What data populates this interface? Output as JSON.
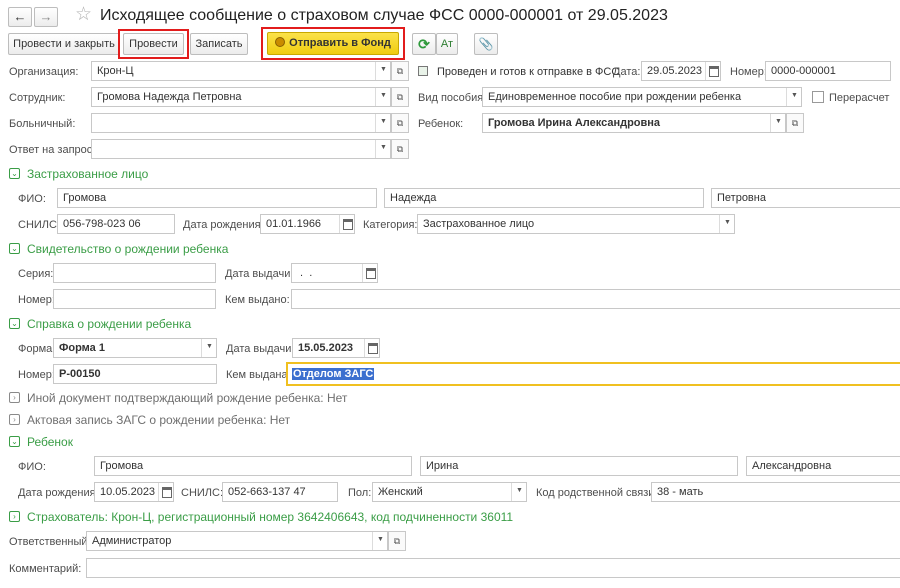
{
  "title": "Исходящее сообщение о страховом случае ФСС 0000-000001 от 29.05.2023",
  "toolbar": {
    "post_close": "Провести и закрыть",
    "post": "Провести",
    "save": "Записать",
    "send": "Отправить в Фонд"
  },
  "header": {
    "org_label": "Организация:",
    "org_value": "Крон-Ц",
    "status_text": "Проведен и готов к отправке в ФСС",
    "date_label": "Дата:",
    "date_value": "29.05.2023",
    "number_label": "Номер:",
    "number_value": "0000-000001",
    "employee_label": "Сотрудник:",
    "employee_value": "Громова Надежда Петровна",
    "benefit_label": "Вид пособия:",
    "benefit_value": "Единовременное пособие при рождении ребенка",
    "recalc_label": "Перерасчет",
    "sick_label": "Больничный:",
    "sick_value": "",
    "child_label": "Ребенок:",
    "child_value": "Громова Ирина Александровна",
    "reply_label": "Ответ на запрос:",
    "reply_value": ""
  },
  "insured": {
    "title": "Застрахованное лицо",
    "fio_label": "ФИО:",
    "last": "Громова",
    "first": "Надежда",
    "middle": "Петровна",
    "snils_label": "СНИЛС:",
    "snils": "056-798-023 06",
    "birth_label": "Дата рождения:",
    "birth": "01.01.1966",
    "category_label": "Категория:",
    "category": "Застрахованное лицо"
  },
  "birth_cert": {
    "title": "Свидетельство о рождении ребенка",
    "series_label": "Серия:",
    "series": "",
    "issue_date_label": "Дата выдачи:",
    "issue_date": " .  .",
    "number_label": "Номер:",
    "number": "",
    "issued_by_label": "Кем выдано:",
    "issued_by": ""
  },
  "birth_ref": {
    "title": "Справка о рождении ребенка",
    "form_label": "Форма:",
    "form": "Форма 1",
    "issue_date_label": "Дата выдачи:",
    "issue_date": "15.05.2023",
    "number_label": "Номер:",
    "number": "Р-00150",
    "issued_by_label": "Кем выдана:",
    "issued_by": "Отделом ЗАГС"
  },
  "other_doc": "Иной документ подтверждающий рождение ребенка: Нет",
  "zags_record": "Актовая запись ЗАГС о рождении ребенка: Нет",
  "child": {
    "title": "Ребенок",
    "fio_label": "ФИО:",
    "last": "Громова",
    "first": "Ирина",
    "middle": "Александровна",
    "birth_label": "Дата рождения:",
    "birth": "10.05.2023",
    "snils_label": "СНИЛС:",
    "snils": "052-663-137 47",
    "gender_label": "Пол:",
    "gender": "Женский",
    "relation_label": "Код родственной связи:",
    "relation": "38 - мать"
  },
  "insurer": "Страхователь: Крон-Ц, регистрационный номер 3642406643, код подчиненности 36011",
  "footer": {
    "responsible_label": "Ответственный:",
    "responsible": "Администратор",
    "comment_label": "Комментарий:",
    "comment": ""
  },
  "colors": {
    "accent_green": "#3a9d46",
    "send_yellow": "#f5d21b",
    "highlight_red": "#e21c1c",
    "focus_yellow": "#f0c020",
    "selection_blue": "#3b6fcf"
  }
}
